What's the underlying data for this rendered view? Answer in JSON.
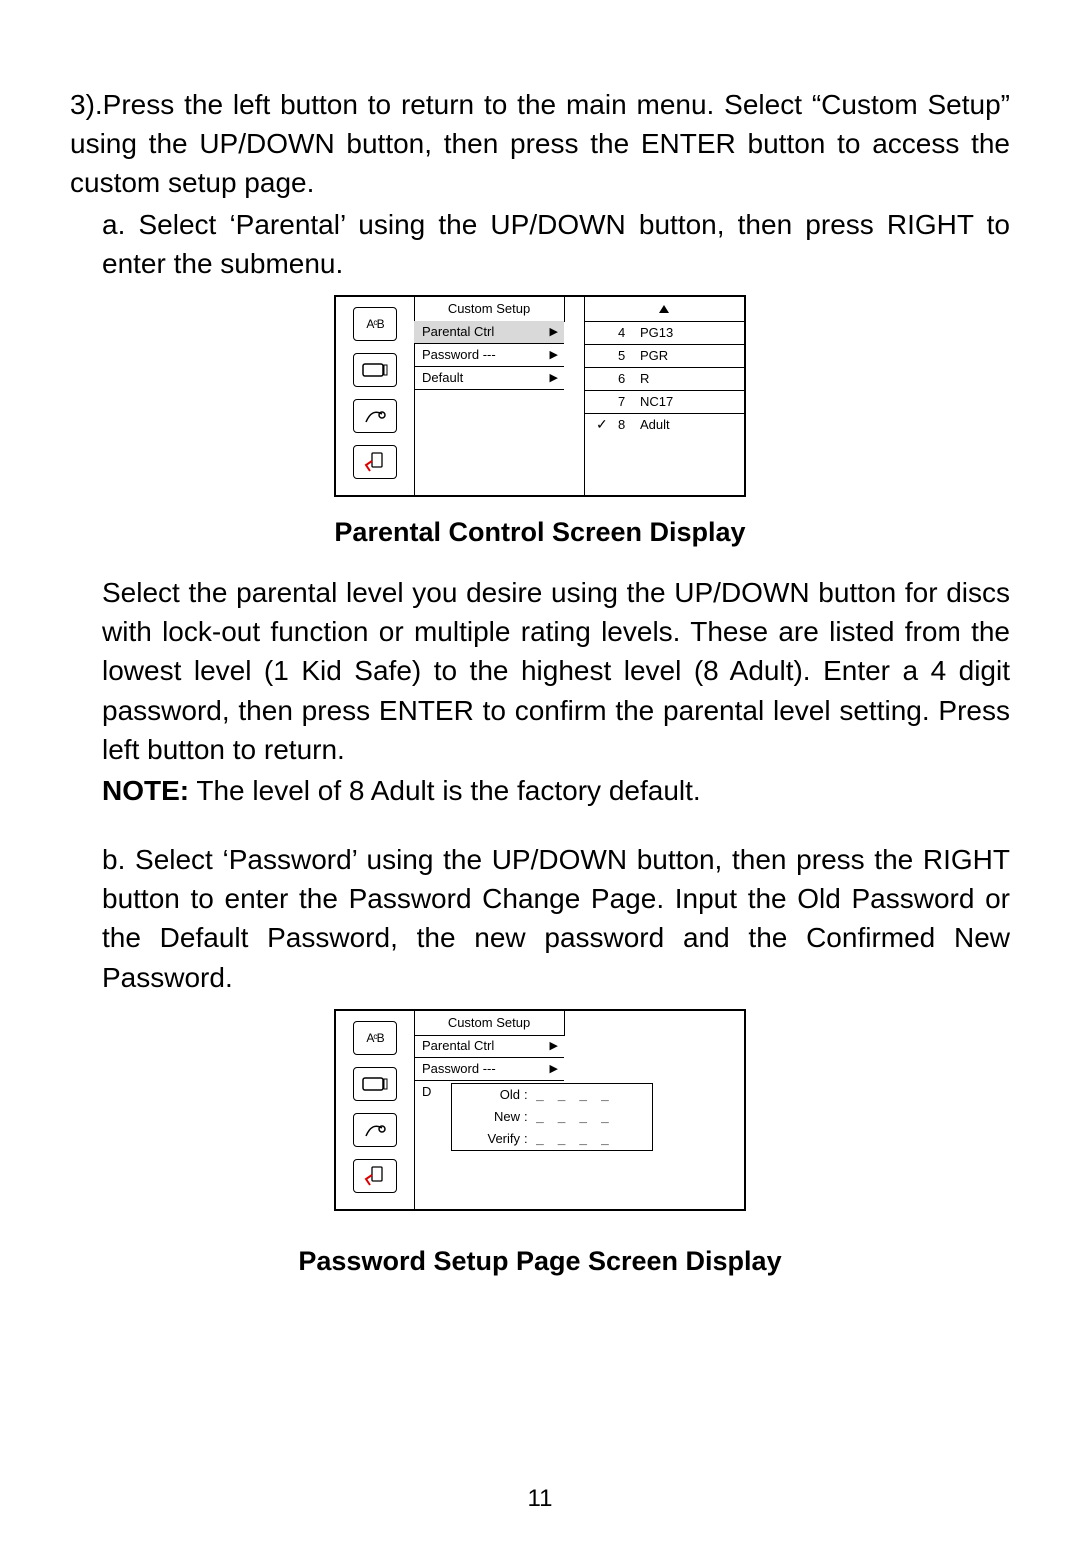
{
  "text": {
    "p1": "3).Press the left button to return to the main menu. Select “Custom Set­up” using the UP/DOWN button, then press the ENTER button to access the custom setup page.",
    "p2": "a. Select ‘Parental’ using the UP/DOWN button, then press RIGHT to enter the submenu.",
    "cap1": "Parental Control Screen Display",
    "p3": "Select the parental level you desire using the UP/DOWN button for discs with lock-out function or multiple rating levels. These are listed from the lowest level (1 Kid Safe) to the highest level (8 Adult). Enter a 4 digit password, then press ENTER to confirm the parental level set­ting. Press left button to return.",
    "noteLabel": "NOTE:",
    "noteBody": " The level of 8 Adult is the factory default.",
    "p4": "b. Select ‘Password’ using the UP/DOWN button, then press the RIGHT button to enter the Password Change Page. Input the Old  Password or the Default Password, the new password and the Confirmed New Password.",
    "cap2": "Password Setup Page Screen Display",
    "pageNumber": "11"
  },
  "screen1": {
    "title": "Custom Setup",
    "menu": [
      {
        "label": "Parental Ctrl",
        "selected": true
      },
      {
        "label": "Password  ---",
        "selected": false
      },
      {
        "label": "Default",
        "selected": false
      }
    ],
    "ratings": [
      {
        "num": "4",
        "lbl": "PG13",
        "checked": false
      },
      {
        "num": "5",
        "lbl": "PGR",
        "checked": false
      },
      {
        "num": "6",
        "lbl": "R",
        "checked": false
      },
      {
        "num": "7",
        "lbl": "NC17",
        "checked": false
      },
      {
        "num": "8",
        "lbl": "Adult",
        "checked": true
      }
    ]
  },
  "screen2": {
    "title": "Custom Setup",
    "menu": [
      {
        "label": "Parental Ctrl"
      },
      {
        "label": "Password  ---"
      },
      {
        "label": "D"
      }
    ],
    "pw": {
      "rows": [
        {
          "k": "Old",
          "dashes": "_ _ _ _"
        },
        {
          "k": "New",
          "dashes": "_ _ _ _"
        },
        {
          "k": "Verify",
          "dashes": "_ _ _ _"
        }
      ]
    }
  }
}
